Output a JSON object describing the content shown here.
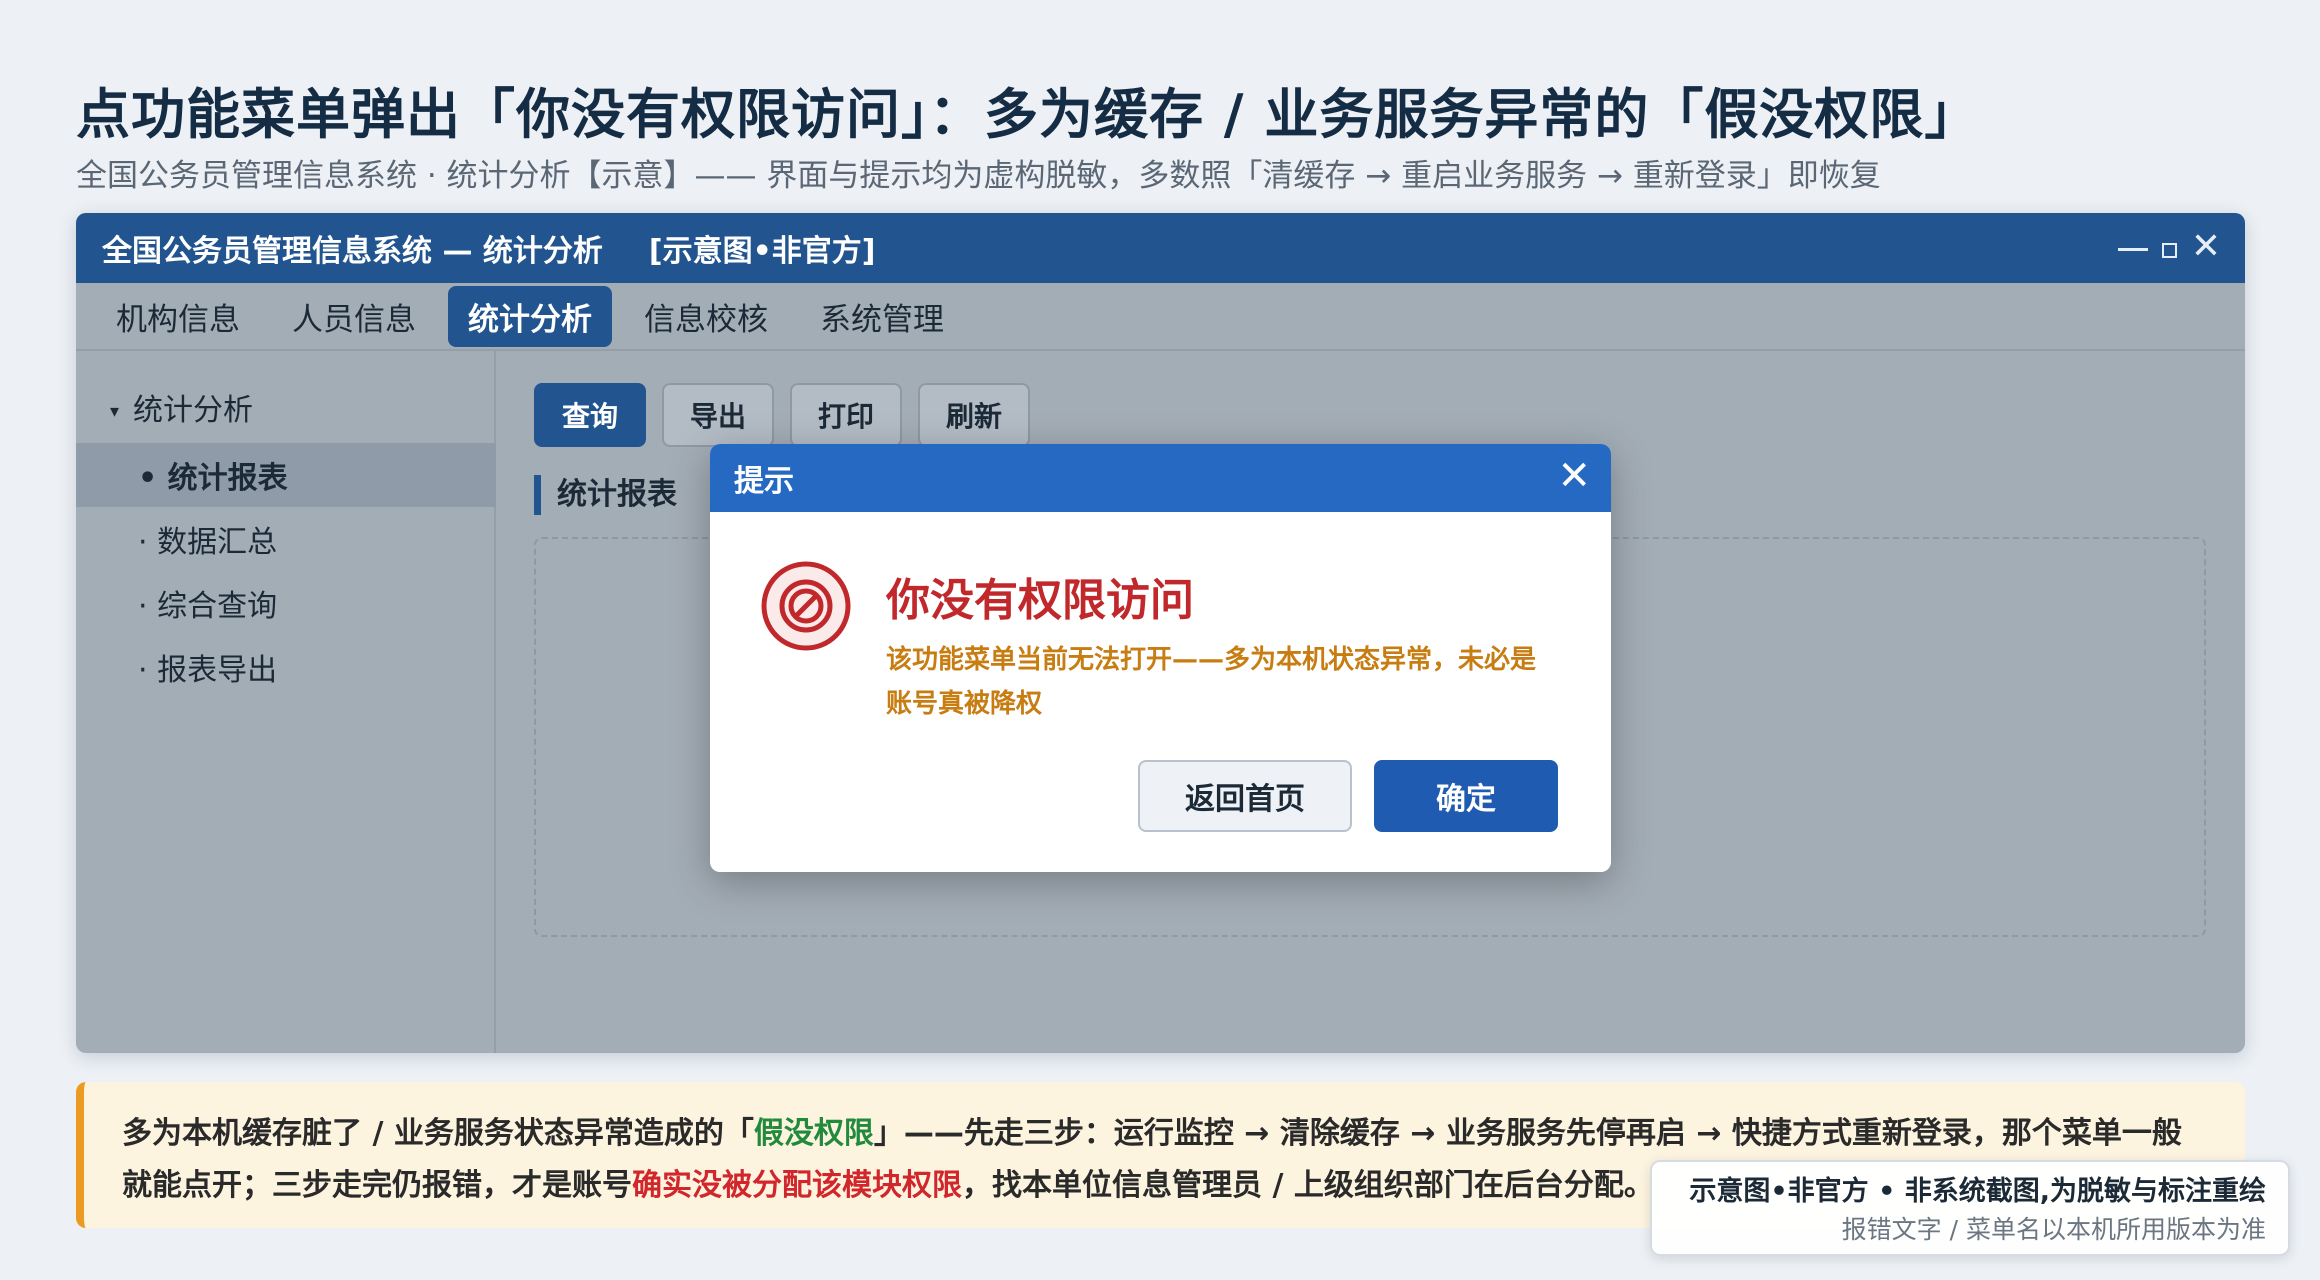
{
  "header": {
    "title": "点功能菜单弹出「你没有权限访问」：多为缓存 / 业务服务异常的「假没权限」",
    "subtitle": "全国公务员管理信息系统 · 统计分析【示意】—— 界面与提示均为虚构脱敏，多数照「清缓存 → 重启业务服务 → 重新登录」即恢复"
  },
  "window": {
    "title": "全国公务员管理信息系统 — 统计分析",
    "tag": "[示意图•非官方]",
    "menus": [
      "机构信息",
      "人员信息",
      "统计分析",
      "信息校核",
      "系统管理"
    ],
    "active_menu": "统计分析"
  },
  "sidebar": {
    "root": "统计分析",
    "items": [
      "• 统计报表",
      "· 数据汇总",
      "· 综合查询",
      "· 报表导出"
    ]
  },
  "toolbar": {
    "buttons": [
      "查询",
      "导出",
      "打印",
      "刷新"
    ]
  },
  "content": {
    "section_label": "统计报表"
  },
  "dialog": {
    "header": "提示",
    "close": "✕",
    "title": "你没有权限访问",
    "message": "该功能菜单当前无法打开——多为本机状态异常，未必是账号真被降权",
    "btn_secondary": "返回首页",
    "btn_primary": "确定"
  },
  "tip": {
    "part1": "多为本机缓存脏了 / 业务服务状态异常造成的「",
    "highlight_green": "假没权限",
    "part2": "」——先走三步：运行监控 → 清除缓存 → 业务服务先停再启 → 快捷方式重新登录，那个菜单一般就能点开；三步走完仍报错，才是账号",
    "highlight_red": "确实没被分配该模块权限",
    "part3": "，找本单位信息管理员 / 上级组织部门在后台分配。"
  },
  "disclaimer": {
    "line1": "示意图•非官方 • 非系统截图,为脱敏与标注重绘",
    "line2": "报错文字 / 菜单名以本机所用版本为准"
  },
  "colors": {
    "primary": "#22558f",
    "dialog_header": "#2669c2",
    "error_red": "#c0282b",
    "warning_orange": "#c77d12",
    "tip_accent": "#ec9b22"
  },
  "icons": {
    "dialog": "no-entry-icon",
    "window_controls": [
      "minimize-icon",
      "maximize-icon",
      "close-icon"
    ]
  }
}
